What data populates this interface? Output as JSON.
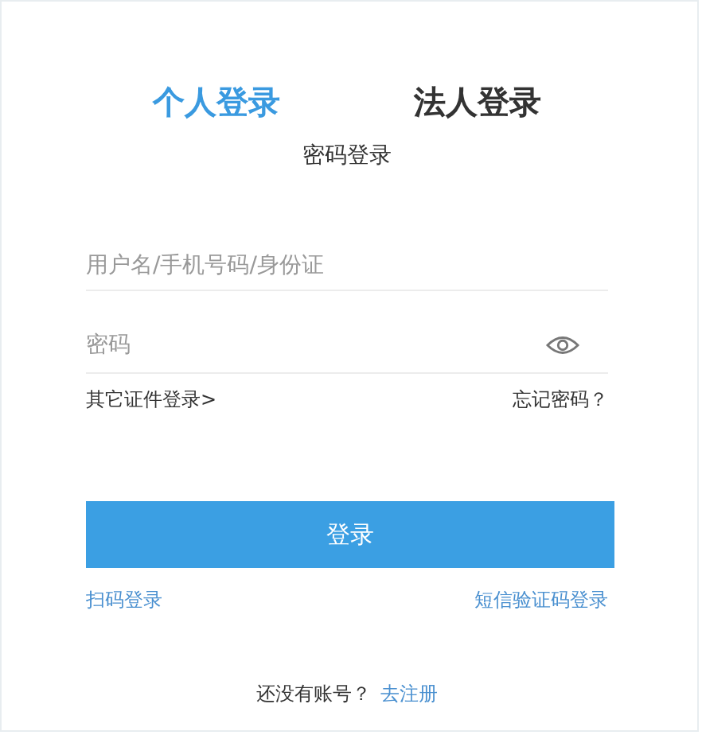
{
  "tabs": [
    {
      "label": "个人登录",
      "selected": true
    },
    {
      "label": "法人登录",
      "selected": false
    }
  ],
  "subtitle": "密码登录",
  "username": {
    "placeholder": "用户名/手机号码/身份证"
  },
  "password": {
    "placeholder": "密码"
  },
  "other_id_link": "其它证件登录>",
  "forgot_link": "忘记密码？",
  "login_button": "登录",
  "qr_link": "扫码登录",
  "sms_link": "短信验证码登录",
  "footer": {
    "text": "还没有账号？",
    "link": "去注册"
  }
}
